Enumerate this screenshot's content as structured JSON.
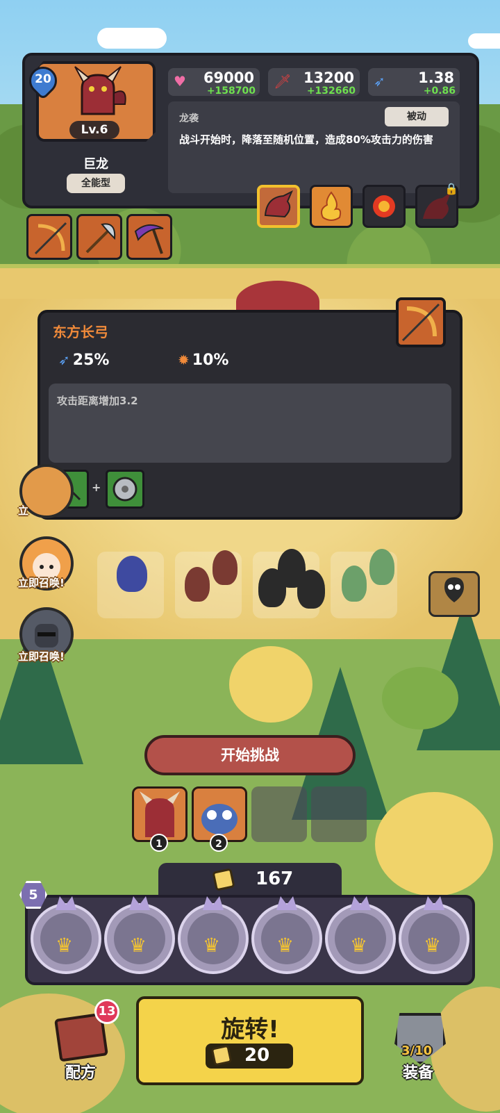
{
  "hero": {
    "star_level": "20",
    "level": "Lv.6",
    "name": "巨龙",
    "type": "全能型",
    "stats": {
      "hp": {
        "value": "69000",
        "bonus": "+158700",
        "icon": "heart-icon"
      },
      "attack": {
        "value": "13200",
        "bonus": "+132660",
        "icon": "sword-icon"
      },
      "speed": {
        "value": "1.38",
        "bonus": "+0.86",
        "icon": "speed-icon"
      }
    },
    "skill": {
      "name": "龙袭",
      "tag": "被动",
      "description": "战斗开始时，降落至随机位置，造成80%攻击力的伤害"
    }
  },
  "item_tooltip": {
    "title": "东方长弓",
    "stat1": "25%",
    "stat2": "10%",
    "description": "攻击距离增加3.2",
    "recipe_plus": "+"
  },
  "summon": {
    "label_1": "立即召唤!",
    "label_2": "立即召唤!",
    "label_partial": "立"
  },
  "battle": {
    "challenge_label": "开始挑战",
    "team_slot_1": "1",
    "team_slot_2": "2"
  },
  "spin": {
    "currency": "167",
    "reel_count": "5",
    "label": "旋转!",
    "cost": "20"
  },
  "nav": {
    "recipe_label": "配方",
    "recipe_badge": "13",
    "equip_label": "装备",
    "equip_count": "3/10"
  },
  "colors": {
    "accent_orange": "#f08a3a",
    "bonus_green": "#6ee04f",
    "spin_yellow": "#f4d34a",
    "challenge_red": "#b3514a"
  }
}
